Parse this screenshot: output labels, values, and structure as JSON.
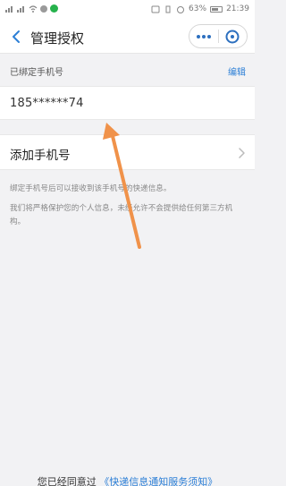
{
  "status_bar": {
    "battery": "63%",
    "time": "21:39"
  },
  "header": {
    "title": "管理授权"
  },
  "bound_phone": {
    "section_label": "已绑定手机号",
    "edit_label": "编辑",
    "phone": "185******74"
  },
  "add_phone": {
    "label": "添加手机号"
  },
  "notes": [
    "绑定手机号后可以接收到该手机号的快递信息。",
    "我们将严格保护您的个人信息，未经允许不会提供给任何第三方机构。"
  ],
  "footer": {
    "prefix": "您已经同意过",
    "link": "《快递信息通知服务须知》"
  },
  "colors": {
    "accent": "#2c7fd6",
    "annotation_arrow": "#f0924a"
  },
  "icons": {
    "back": "chevron-left-icon",
    "more": "more-dots-icon",
    "close": "close-circle-icon",
    "row_arrow": "chevron-right-icon"
  }
}
